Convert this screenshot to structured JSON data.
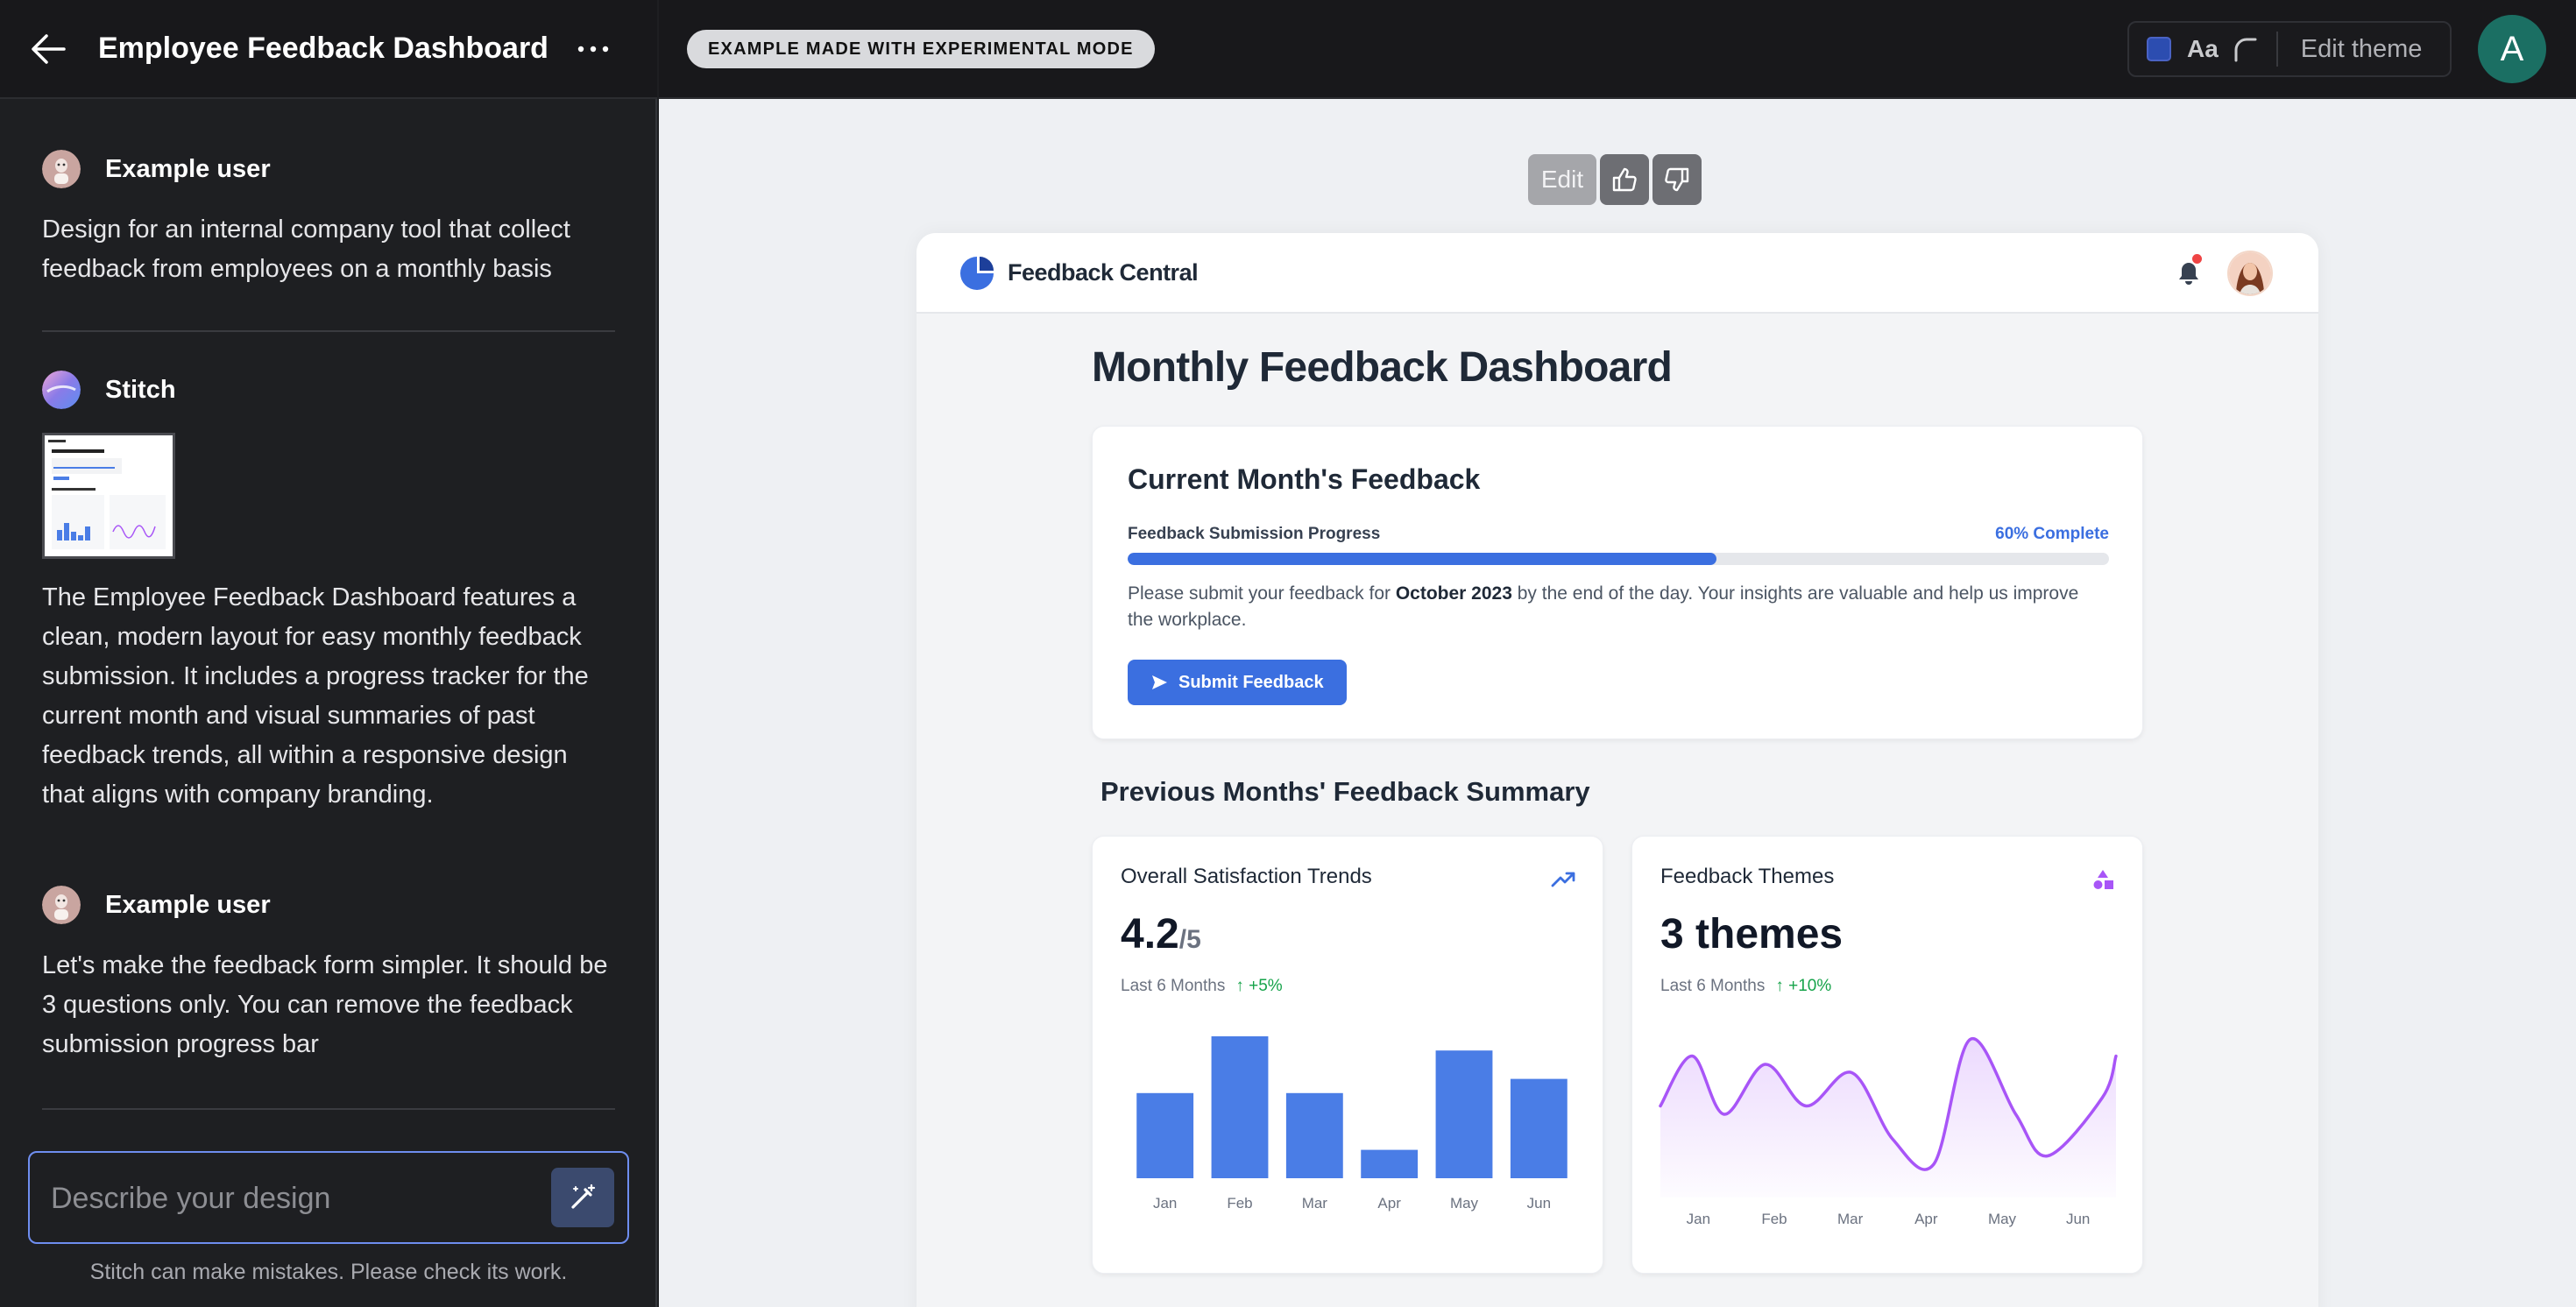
{
  "sidebar": {
    "title": "Employee Feedback Dashboard",
    "messages": [
      {
        "sender": "Example user",
        "text": "Design for an internal company tool that collect feedback from employees on a monthly basis"
      },
      {
        "sender": "Stitch",
        "text": "The Employee Feedback Dashboard features a clean, modern layout for easy monthly feedback submission. It includes a progress tracker for the current month and visual summaries of past feedback trends, all within a responsive design that aligns with company branding."
      },
      {
        "sender": "Example user",
        "text": "Let's make the feedback form simpler. It should be 3 questions only. You can remove the feedback submission progress bar"
      }
    ],
    "input_placeholder": "Describe your design",
    "disclaimer": "Stitch can make mistakes. Please check its work."
  },
  "topbar": {
    "badge": "EXAMPLE MADE WITH EXPERIMENTAL MODE",
    "font_label": "Aa",
    "edit_theme": "Edit theme",
    "user_initial": "A",
    "theme_color": "#2c4db0"
  },
  "toolbar": {
    "edit_label": "Edit"
  },
  "preview": {
    "brand": "Feedback Central",
    "page_title": "Monthly Feedback Dashboard",
    "current": {
      "title": "Current Month's Feedback",
      "progress_label": "Feedback Submission Progress",
      "progress_text": "60% Complete",
      "progress_value": 0.6,
      "text_before": "Please submit your feedback for ",
      "text_bold": "October 2023",
      "text_after": " by the end of the day. Your insights are valuable and help us improve the workplace.",
      "submit_label": "Submit Feedback"
    },
    "summary_title": "Previous Months' Feedback Summary",
    "satisfaction": {
      "title": "Overall Satisfaction Trends",
      "value": "4.2",
      "unit": "/5",
      "period": "Last 6 Months",
      "change": "+5%"
    },
    "themes": {
      "title": "Feedback Themes",
      "value": "3 themes",
      "period": "Last 6 Months",
      "change": "+10%"
    },
    "accent": "#3b6fe0",
    "purple": "#a855f7"
  },
  "chart_data": [
    {
      "type": "bar",
      "categories": [
        "Jan",
        "Feb",
        "Mar",
        "Apr",
        "May",
        "Jun"
      ],
      "values": [
        60,
        100,
        60,
        20,
        90,
        70
      ],
      "ylim": [
        0,
        100
      ],
      "color": "#4a7de6"
    },
    {
      "type": "area",
      "categories": [
        "Jan",
        "Feb",
        "Mar",
        "Apr",
        "May",
        "Jun"
      ],
      "x": [
        0,
        0.07,
        0.14,
        0.23,
        0.32,
        0.42,
        0.51,
        0.6,
        0.68,
        0.78,
        0.85,
        0.97,
        1.0
      ],
      "y": [
        55,
        85,
        50,
        80,
        55,
        75,
        35,
        20,
        95,
        50,
        25,
        60,
        85
      ],
      "ylim": [
        0,
        100
      ],
      "color": "#a855f7"
    }
  ]
}
